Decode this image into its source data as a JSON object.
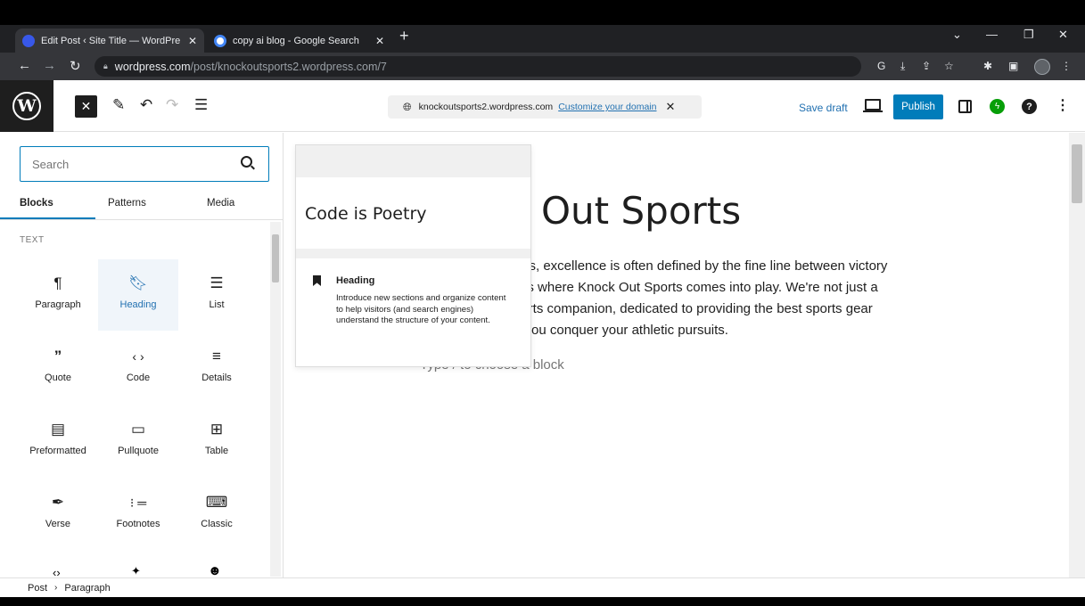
{
  "browser": {
    "tabs": [
      {
        "title": "Edit Post ‹ Site Title — WordPre",
        "active": true
      },
      {
        "title": "copy ai blog - Google Search",
        "active": false
      }
    ],
    "url_host": "wordpress.com",
    "url_path": "/post/knockoutsports2.wordpress.com/7"
  },
  "toolbar": {
    "site_url": "knockoutsports2.wordpress.com",
    "customize_link": "Customize your domain",
    "save_draft": "Save draft",
    "publish": "Publish"
  },
  "inserter": {
    "search_placeholder": "Search",
    "tabs": [
      "Blocks",
      "Patterns",
      "Media"
    ],
    "category": "TEXT",
    "blocks": [
      {
        "label": "Paragraph",
        "icon": "paragraph-icon"
      },
      {
        "label": "Heading",
        "icon": "bookmark-icon"
      },
      {
        "label": "List",
        "icon": "list-icon"
      },
      {
        "label": "Quote",
        "icon": "quote-icon"
      },
      {
        "label": "Code",
        "icon": "code-icon"
      },
      {
        "label": "Details",
        "icon": "details-icon"
      },
      {
        "label": "Preformatted",
        "icon": "preformatted-icon"
      },
      {
        "label": "Pullquote",
        "icon": "pullquote-icon"
      },
      {
        "label": "Table",
        "icon": "table-icon"
      },
      {
        "label": "Verse",
        "icon": "feather-icon"
      },
      {
        "label": "Footnotes",
        "icon": "footnotes-icon"
      },
      {
        "label": "Classic",
        "icon": "keyboard-icon"
      }
    ]
  },
  "preview": {
    "sample_text": "Code is Poetry",
    "block_name": "Heading",
    "description": "Introduce new sections and organize content to help visitors (and search engines) understand the structure of your content."
  },
  "canvas": {
    "title_fragment": "Out Sports",
    "paragraph_lines": [
      "orts, excellence is often defined by the fine line between victory",
      "at's where Knock Out Sports comes into play. We're not just a",
      "ports companion, dedicated to providing the best sports gear",
      "p you conquer your athletic pursuits."
    ],
    "placeholder": "Type / to choose a block"
  },
  "breadcrumb": [
    "Post",
    "Paragraph"
  ],
  "colors": {
    "accent": "#007cba",
    "wp_dark": "#1e1e1e",
    "chrome_dark": "#202124"
  }
}
